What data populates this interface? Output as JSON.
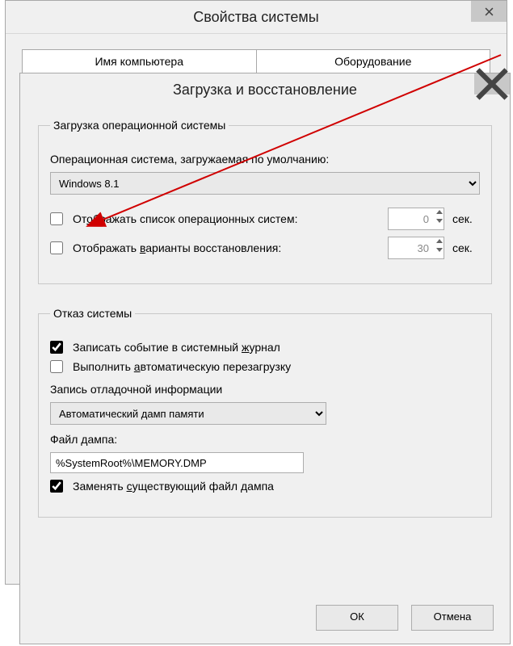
{
  "parent": {
    "title": "Свойства системы",
    "tabs": [
      {
        "label": "Имя компьютера"
      },
      {
        "label": "Оборудование"
      }
    ]
  },
  "child": {
    "title": "Загрузка и восстановление",
    "section_boot": {
      "legend": "Загрузка операционной системы",
      "default_os_label": "Операционная система, загружаемая по умолчанию:",
      "default_os_value": "Windows 8.1",
      "show_os_list_label_1": "От",
      "show_os_list_label_2": "бражать список операционных систем:",
      "show_os_list_checked": false,
      "show_os_list_value": "0",
      "show_recovery_label_1": "Отображать ",
      "show_recovery_label_2": "арианты восстановления:",
      "show_recovery_checked": false,
      "show_recovery_value": "30",
      "seconds_unit": "сек."
    },
    "section_fail": {
      "legend": "Отказ системы",
      "log_event_label_1": "Записать событие в системный ",
      "log_event_label_2": "урнал",
      "log_event_checked": true,
      "auto_restart_label_1": "Выполнить ",
      "auto_restart_label_2": "втоматическую перезагрузку",
      "auto_restart_checked": false,
      "dump_info_label": "Запись отладочной информации",
      "dump_type_value": "Автоматический дамп памяти",
      "dump_file_label": "Файл дампа:",
      "dump_file_value": "%SystemRoot%\\MEMORY.DMP",
      "overwrite_label_1": "Заменять ",
      "overwrite_label_2": "уществующий файл дампа",
      "overwrite_checked": true
    },
    "buttons": {
      "ok": "ОК",
      "cancel": "Отмена"
    }
  }
}
